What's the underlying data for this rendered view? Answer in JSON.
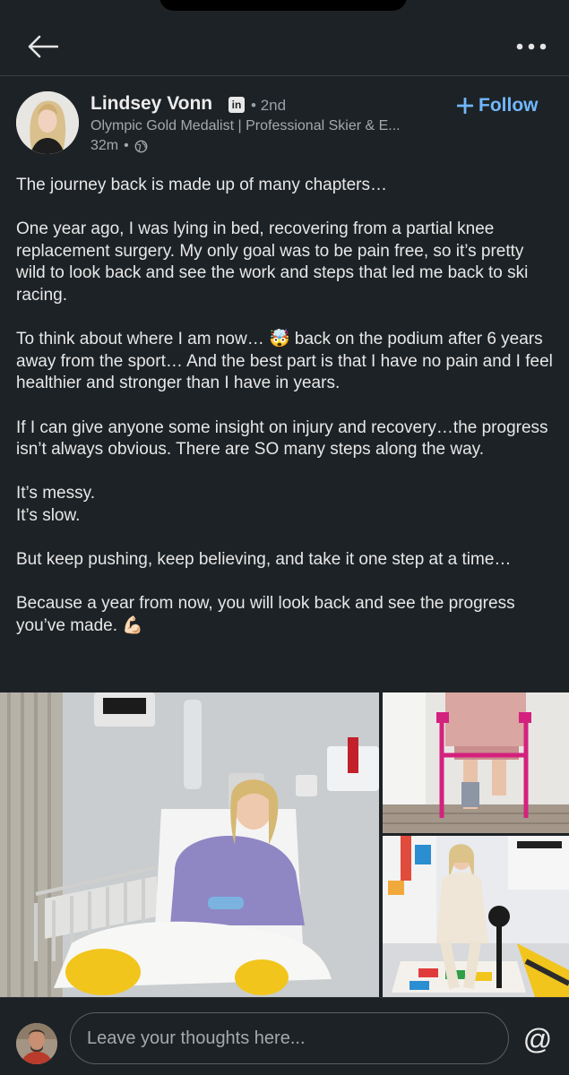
{
  "author": {
    "name": "Lindsey Vonn",
    "badge": "in",
    "degree": "2nd",
    "headline": "Olympic Gold Medalist | Professional Skier & E...",
    "time": "32m",
    "visibility_icon": "globe-icon"
  },
  "follow": {
    "label": "Follow",
    "icon": "plus-icon"
  },
  "post": {
    "paragraphs": [
      "The journey back is made up of many chapters…",
      "One year ago, I was lying in bed, recovering from a partial knee replacement surgery. My only goal was to be pain free, so it’s pretty wild to look back and see the work and steps that led me back to ski racing.",
      "To think about where I am now… 🤯 back on the podium after 6 years away from the sport… And the best part is that I have no pain and I feel healthier and stronger than I have in years.",
      "If I can give anyone some insight on injury and recovery…the progress isn’t always obvious. There are SO many steps along the way.",
      "It’s messy.",
      "It’s slow.",
      "But keep pushing, keep believing, and take it one step at a time…",
      "Because a year from now, you will look back and see the progress you’ve made. 💪🏻"
    ]
  },
  "comment": {
    "placeholder": "Leave your thoughts here...",
    "mention_symbol": "@"
  },
  "colors": {
    "background": "#1d2226",
    "accent": "#71b7fb",
    "text": "#e7e7e7",
    "muted": "#a4a9ad"
  }
}
